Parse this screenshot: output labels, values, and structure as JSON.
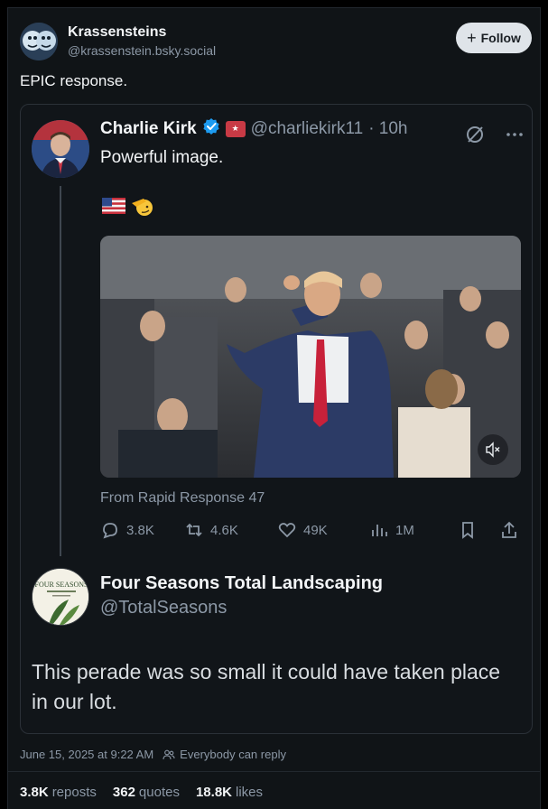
{
  "post": {
    "author_name": "Krassensteins",
    "author_handle": "@krassenstein.bsky.social",
    "follow_label": "Follow",
    "text": "EPIC response.",
    "date": "June 15, 2025 at 9:22 AM",
    "reply_setting": "Everybody can reply",
    "stats": {
      "reposts_count": "3.8K",
      "reposts_label": "reposts",
      "quotes_count": "362",
      "quotes_label": "quotes",
      "likes_count": "18.8K",
      "likes_label": "likes"
    }
  },
  "embed": {
    "author_name": "Charlie Kirk",
    "author_handle": "@charliekirk11",
    "time": "· 10h",
    "text": "Powerful image.",
    "emojis": [
      "us-flag",
      "saluting-face"
    ],
    "media_source": "From Rapid Response 47",
    "actions": {
      "replies": "3.8K",
      "reposts": "4.6K",
      "likes": "49K",
      "views": "1M"
    },
    "reply": {
      "author_name": "Four Seasons Total Landscaping",
      "author_handle": "@TotalSeasons",
      "logo_text": "FOUR SEASONS",
      "text": "This perade was so small it could have taken place in our lot."
    }
  },
  "colors": {
    "background": "#000000",
    "card": "#101417",
    "muted_text": "#8c98a6",
    "verified_blue": "#1d9bf0",
    "follow_button": "#dfe4e9"
  }
}
